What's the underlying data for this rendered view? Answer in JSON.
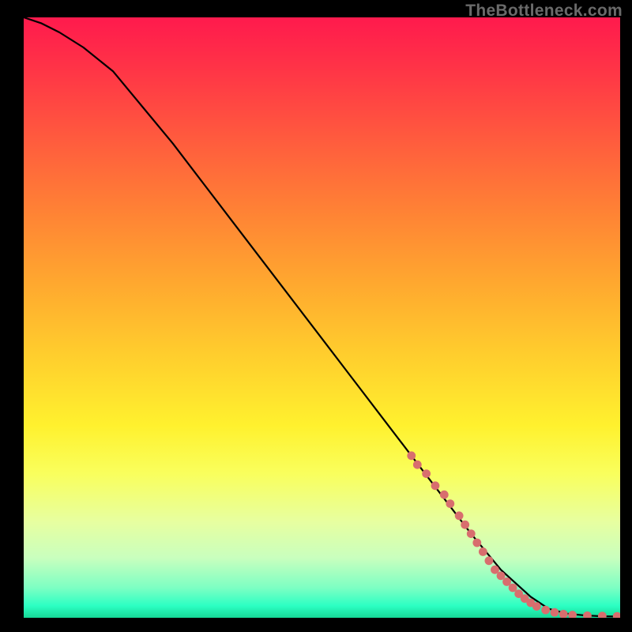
{
  "watermark": "TheBottleneck.com",
  "chart_data": {
    "type": "line",
    "title": "",
    "xlabel": "",
    "ylabel": "",
    "xlim": [
      0,
      100
    ],
    "ylim": [
      0,
      100
    ],
    "grid": false,
    "legend": false,
    "series": [
      {
        "name": "bottleneck-curve",
        "stroke": "#000000",
        "x": [
          0,
          3,
          6,
          10,
          15,
          20,
          25,
          30,
          35,
          40,
          45,
          50,
          55,
          60,
          65,
          70,
          75,
          80,
          85,
          88,
          91,
          94,
          97,
          100
        ],
        "y": [
          100,
          99,
          97.5,
          95,
          91,
          85,
          79,
          72.5,
          66,
          59.5,
          53,
          46.5,
          40,
          33.5,
          27,
          20.5,
          14,
          8,
          3.5,
          1.5,
          0.7,
          0.4,
          0.25,
          0.2
        ]
      }
    ],
    "markers": {
      "name": "highlight-range",
      "color": "#d86e6e",
      "radius": 5.4,
      "x": [
        65,
        66,
        67.5,
        69,
        70.5,
        71.5,
        73,
        74,
        75,
        76,
        77,
        78,
        79,
        80,
        81,
        82,
        83,
        84,
        85,
        86,
        87.5,
        89,
        90.5,
        92,
        94.5,
        97,
        99.5
      ],
      "y": [
        27,
        25.5,
        24,
        22,
        20.5,
        19,
        17,
        15.5,
        14,
        12.5,
        11,
        9.5,
        8,
        7,
        6,
        5,
        4,
        3.2,
        2.5,
        1.9,
        1.3,
        0.9,
        0.6,
        0.45,
        0.35,
        0.3,
        0.25
      ]
    }
  }
}
